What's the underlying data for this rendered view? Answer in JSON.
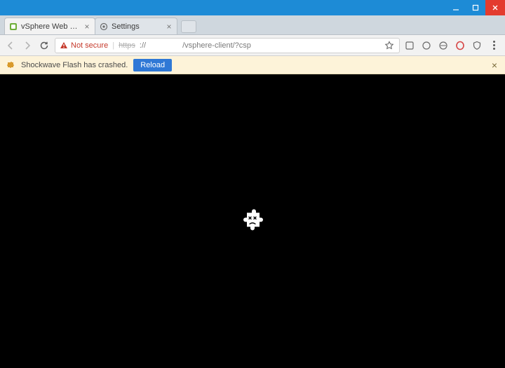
{
  "window": {
    "minimize_glyph": "—",
    "maximize_glyph": "□",
    "close_glyph": "✕"
  },
  "tabs": [
    {
      "label": "vSphere Web Client",
      "active": true
    },
    {
      "label": "Settings",
      "active": false
    }
  ],
  "toolbar": {
    "security_label": "Not secure",
    "url_protocol": "https",
    "url_sep": "://",
    "url_path": "/vsphere-client/?csp"
  },
  "infobar": {
    "message": "Shockwave Flash has crashed.",
    "reload_label": "Reload"
  }
}
